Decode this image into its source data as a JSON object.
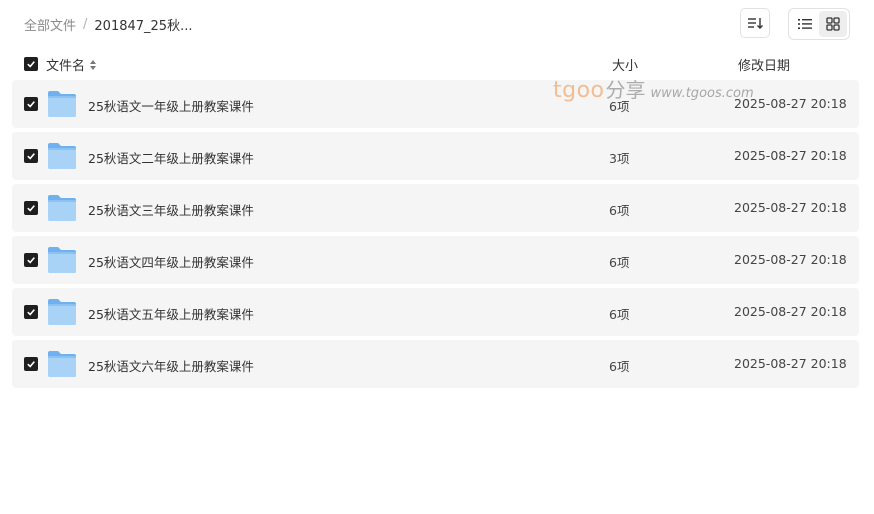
{
  "breadcrumb": {
    "root": "全部文件",
    "separator": "/",
    "current": "201847_25秋..."
  },
  "toolbar": {
    "sort_icon": "sort-list-icon",
    "view_modes": [
      {
        "icon": "list-view-icon",
        "active": true
      },
      {
        "icon": "grid-view-icon",
        "active": false
      }
    ]
  },
  "table": {
    "columns": {
      "name": "文件名",
      "size": "大小",
      "date": "修改日期"
    },
    "all_checked": true,
    "rows": [
      {
        "name": "25秋语文一年级上册教案课件",
        "size": "6项",
        "date": "2025-08-27 20:18",
        "checked": true
      },
      {
        "name": "25秋语文二年级上册教案课件",
        "size": "3项",
        "date": "2025-08-27 20:18",
        "checked": true
      },
      {
        "name": "25秋语文三年级上册教案课件",
        "size": "6项",
        "date": "2025-08-27 20:18",
        "checked": true
      },
      {
        "name": "25秋语文四年级上册教案课件",
        "size": "6项",
        "date": "2025-08-27 20:18",
        "checked": true
      },
      {
        "name": "25秋语文五年级上册教案课件",
        "size": "6项",
        "date": "2025-08-27 20:18",
        "checked": true
      },
      {
        "name": "25秋语文六年级上册教案课件",
        "size": "6项",
        "date": "2025-08-27 20:18",
        "checked": true
      }
    ]
  },
  "watermark": {
    "logo": "tgoo",
    "share": "分享",
    "url": "www.tgoos.com"
  },
  "colors": {
    "row_bg": "#f5f5f5",
    "checkbox": "#1f1f1f",
    "folder_light": "#a9d2f7",
    "folder_dark": "#6fb1ee",
    "watermark_orange": "#f2b483"
  }
}
